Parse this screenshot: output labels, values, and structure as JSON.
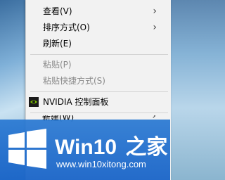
{
  "menu": {
    "items": [
      {
        "label": "查看(V)",
        "submenu": true,
        "enabled": true
      },
      {
        "label": "排序方式(O)",
        "submenu": true,
        "enabled": true
      },
      {
        "label": "刷新(E)",
        "submenu": false,
        "enabled": true
      },
      {
        "label": "粘贴(P)",
        "submenu": false,
        "enabled": false
      },
      {
        "label": "粘贴快捷方式(S)",
        "submenu": false,
        "enabled": false
      },
      {
        "label": "NVIDIA 控制面板",
        "submenu": false,
        "enabled": true,
        "icon": "nvidia-icon"
      },
      {
        "label": "新建(W)",
        "submenu": true,
        "enabled": true
      }
    ],
    "submenu_arrow": "›"
  },
  "watermark": {
    "title_win": "Win10",
    "title_cn": "之家",
    "url": "www.win10xitong.com",
    "icon": "windows-logo-icon",
    "color": "#1f6fd0"
  }
}
